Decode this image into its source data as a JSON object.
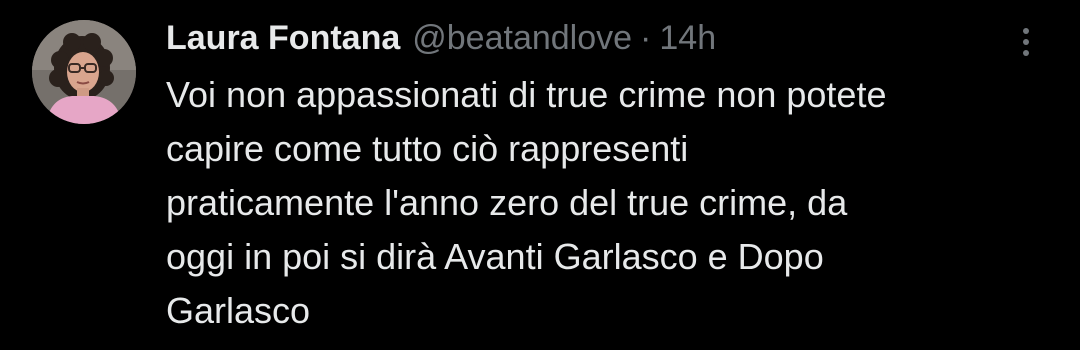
{
  "tweet": {
    "author": {
      "display_name": "Laura Fontana",
      "handle": "@beatandlove",
      "separator": "·",
      "time": "14h",
      "avatar_icon": "profile-photo"
    },
    "more_icon": "more-vertical-icon",
    "text_lines": [
      "Voi non appassionati di true crime non potete",
      "capire come tutto ciò rappresenti",
      "praticamente l'anno zero del true crime, da",
      "oggi in poi si dirà Avanti Garlasco e Dopo",
      "Garlasco"
    ],
    "colors": {
      "background": "#000000",
      "primary_text": "#e7e9ea",
      "secondary_text": "#71767b"
    }
  }
}
